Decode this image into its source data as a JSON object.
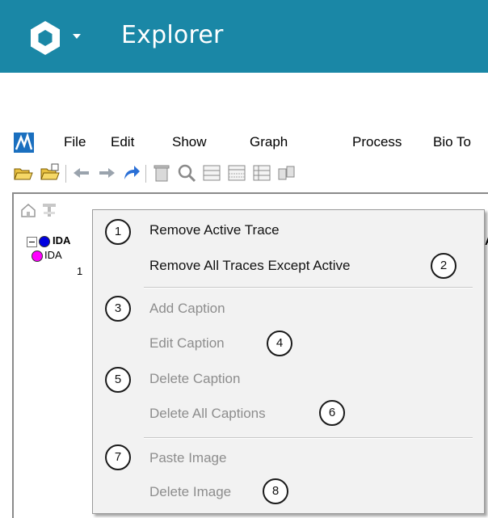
{
  "app_header": {
    "title": "Explorer",
    "background_color": "#1a87a6",
    "logo_icon": "hexagon-logo-icon",
    "menu_caret_icon": "chevron-down-icon"
  },
  "menubar": {
    "app_icon": "app-logo-icon",
    "items": [
      "File",
      "Edit",
      "Show",
      "Graph",
      "Process",
      "Bio To"
    ]
  },
  "toolbar": {
    "icons": [
      "open-folder-icon",
      "open-folder-add-icon",
      "back-icon",
      "forward-icon",
      "link-arrow-icon",
      "trash-icon",
      "zoom-icon",
      "table-icon",
      "grid-icon",
      "list-icon",
      "compare-icon"
    ]
  },
  "tree": {
    "items": [
      {
        "label": "IDA",
        "dot_color": "#0000e0"
      },
      {
        "label": "IDA",
        "dot_color": "#ff00ff"
      },
      {
        "label": "1"
      }
    ],
    "right_fragments": [
      "DA",
      ")"
    ]
  },
  "context_menu": {
    "items": [
      {
        "label": "Remove Active Trace",
        "enabled": true,
        "badge": "1"
      },
      {
        "label": "Remove All Traces Except Active",
        "enabled": true,
        "badge": "2"
      },
      {
        "label": "Add Caption",
        "enabled": false,
        "badge": "3"
      },
      {
        "label": "Edit Caption",
        "enabled": false,
        "badge": "4"
      },
      {
        "label": "Delete Caption",
        "enabled": false,
        "badge": "5"
      },
      {
        "label": "Delete All Captions",
        "enabled": false,
        "badge": "6"
      },
      {
        "label": "Paste Image",
        "enabled": false,
        "badge": "7"
      },
      {
        "label": "Delete Image",
        "enabled": false,
        "badge": "8"
      }
    ]
  }
}
